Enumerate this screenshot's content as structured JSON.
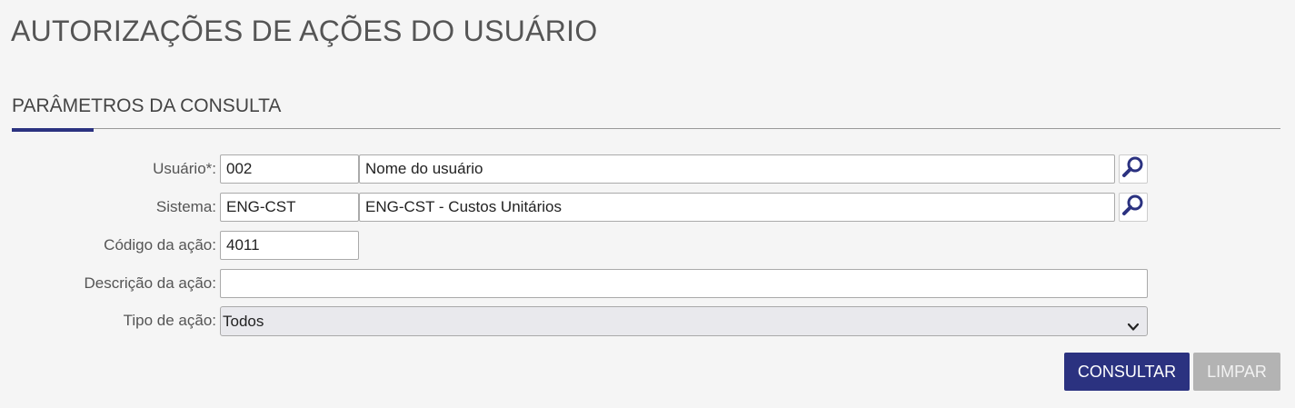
{
  "page": {
    "title": "AUTORIZAÇÕES DE AÇÕES DO USUÁRIO"
  },
  "section": {
    "title": "PARÂMETROS DA CONSULTA"
  },
  "form": {
    "usuario": {
      "label": "Usuário*:",
      "code": "002",
      "name": "Nome do usuário"
    },
    "sistema": {
      "label": "Sistema:",
      "code": "ENG-CST",
      "name": "ENG-CST - Custos Unitários"
    },
    "codigo_acao": {
      "label": "Código da ação:",
      "value": "4011"
    },
    "descricao_acao": {
      "label": "Descrição da ação:",
      "value": ""
    },
    "tipo_acao": {
      "label": "Tipo de ação:",
      "selected": "Todos"
    }
  },
  "buttons": {
    "consultar": "CONSULTAR",
    "limpar": "LIMPAR"
  },
  "colors": {
    "accent": "#2b3280",
    "disabled": "#b3b3b3",
    "background": "#f5f5f5"
  },
  "icons": {
    "lookup": "search-icon",
    "dropdown": "chevron-down-icon"
  }
}
